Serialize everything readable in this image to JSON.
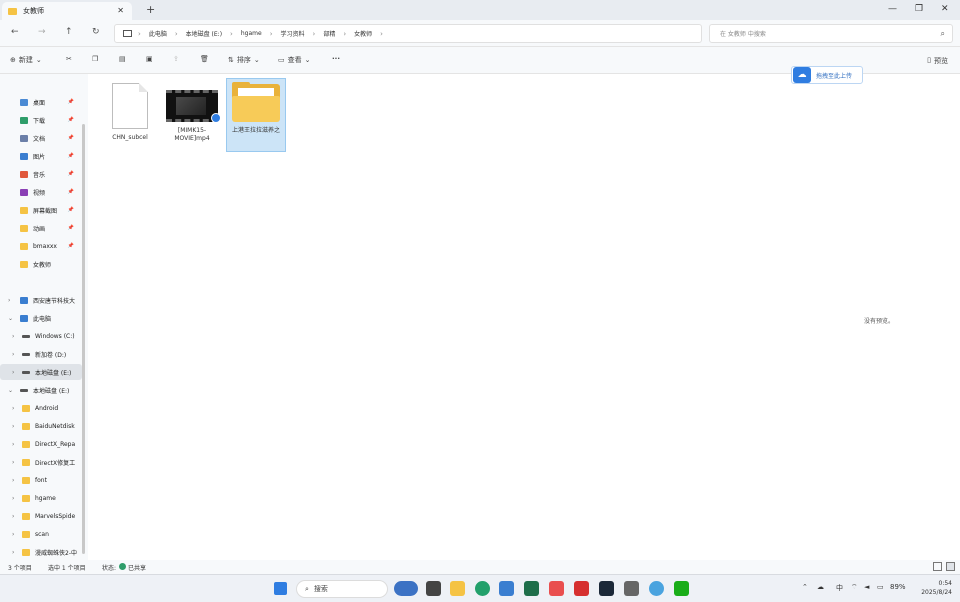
{
  "window": {
    "tab_title": "女教师",
    "tab_close": "✕",
    "new_tab": "+",
    "controls": {
      "minimize": "—",
      "maximize": "❐",
      "close": "✕"
    }
  },
  "nav": {
    "back": "←",
    "forward": "→",
    "up": "↑",
    "refresh": "↻",
    "breadcrumbs": [
      "此电脑",
      "本地磁盘 (E:)",
      "hgame",
      "学习资料",
      "部精",
      "女教师"
    ],
    "search_placeholder": "在 女教师 中搜索"
  },
  "toolbar": {
    "new_label": "新建",
    "sort_label": "排序",
    "view_label": "查看",
    "more_label": "···",
    "preview_label": "预览"
  },
  "sidebar": {
    "quick_access": [
      {
        "label": "桌面",
        "icon": "desktop-icon",
        "color": "#4a8ad4"
      },
      {
        "label": "下载",
        "icon": "download-icon",
        "color": "#2e9d6a"
      },
      {
        "label": "文档",
        "icon": "document-icon",
        "color": "#6b7fa8"
      },
      {
        "label": "图片",
        "icon": "pictures-icon",
        "color": "#3a7ed0"
      },
      {
        "label": "音乐",
        "icon": "music-icon",
        "color": "#e0583c"
      },
      {
        "label": "视频",
        "icon": "video-icon",
        "color": "#8a3fb5"
      },
      {
        "label": "屏幕截图",
        "icon": "folder-icon",
        "color": "#f5c344"
      },
      {
        "label": "动画",
        "icon": "folder-icon",
        "color": "#f5c344"
      },
      {
        "label": "bmaxxx",
        "icon": "folder-icon",
        "color": "#f5c344"
      },
      {
        "label": "女教师",
        "icon": "folder-icon",
        "color": "#f5c344"
      }
    ],
    "tree": [
      {
        "label": "西安唐节科技大",
        "icon": "cloud-drive-icon",
        "color": "#3a7ed0",
        "level": 0
      },
      {
        "label": "此电脑",
        "icon": "pc-icon",
        "color": "#3a7ed0",
        "level": 0
      },
      {
        "label": "Windows (C:)",
        "icon": "drive-icon",
        "color": "#555",
        "level": 1
      },
      {
        "label": "新加卷 (D:)",
        "icon": "drive-icon",
        "color": "#555",
        "level": 1
      },
      {
        "label": "本地磁盘 (E:)",
        "icon": "drive-icon",
        "color": "#555",
        "level": 1,
        "selected": true
      },
      {
        "label": "本地磁盘 (E:)",
        "icon": "drive-icon",
        "color": "#555",
        "level": 0
      },
      {
        "label": "Android",
        "icon": "folder-icon",
        "color": "#f5c344",
        "level": 1
      },
      {
        "label": "BaiduNetdisk",
        "icon": "folder-icon",
        "color": "#f5c344",
        "level": 1
      },
      {
        "label": "DirectX_Repa",
        "icon": "folder-icon",
        "color": "#f5c344",
        "level": 1
      },
      {
        "label": "DirectX修复工",
        "icon": "folder-icon",
        "color": "#f5c344",
        "level": 1
      },
      {
        "label": "font",
        "icon": "folder-icon",
        "color": "#f5c344",
        "level": 1
      },
      {
        "label": "hgame",
        "icon": "folder-icon",
        "color": "#f5c344",
        "level": 1
      },
      {
        "label": "MarvelsSpide",
        "icon": "folder-icon",
        "color": "#f5c344",
        "level": 1
      },
      {
        "label": "scan",
        "icon": "folder-icon",
        "color": "#f5c344",
        "level": 1
      },
      {
        "label": "漫威蜘蛛侠2-中",
        "icon": "folder-icon",
        "color": "#f5c344",
        "level": 1
      }
    ]
  },
  "files": [
    {
      "name": "CHN_subcel",
      "type": "file"
    },
    {
      "name": "[MIMK15-MOVIE]mp4",
      "type": "video"
    },
    {
      "name": "上港王拉拉滋养之",
      "type": "folder",
      "selected": true
    }
  ],
  "upload_button": "拖拽至此上传",
  "preview_empty": "没有预览。",
  "status": {
    "count": "3 个项目",
    "selected": "选中 1 个项目",
    "state_prefix": "状态:",
    "state": "已共享"
  },
  "taskbar": {
    "search_label": "搜索",
    "time": "0:54",
    "date": "2025/8/24",
    "battery": "89%",
    "ime": "中"
  }
}
